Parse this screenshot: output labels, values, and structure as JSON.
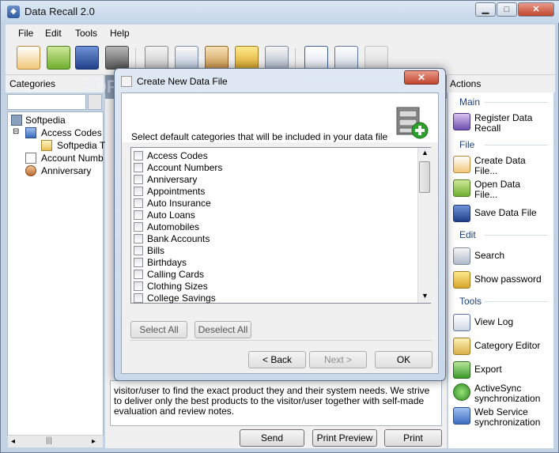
{
  "window": {
    "title": "Data Recall  2.0",
    "min": "▁",
    "max": "□",
    "close": "✕"
  },
  "menu": [
    "File",
    "Edit",
    "Tools",
    "Help"
  ],
  "categories": {
    "header": "Categories",
    "tree": [
      "Softpedia",
      "Access Codes",
      "Softpedia T",
      "Account Numb",
      "Anniversary"
    ],
    "scroll_grip": "|||"
  },
  "center": {
    "header_text": "SOFTPEDIA",
    "description": "visitor/user to find the exact product they and their system needs. We strive to deliver only the best products to the visitor/user together with self-made evaluation and review notes.",
    "buttons": {
      "send": "Send",
      "print_preview": "Print Preview",
      "print": "Print"
    }
  },
  "actions": {
    "header": "Actions",
    "sections": {
      "main": "Main",
      "file": "File",
      "edit": "Edit",
      "tools": "Tools"
    },
    "items": {
      "register": "Register Data Recall",
      "create": "Create Data File...",
      "open": "Open Data File...",
      "save": "Save Data File",
      "search": "Search",
      "show_password": "Show password",
      "view_log": "View Log",
      "category_editor": "Category Editor",
      "export": "Export",
      "activesync": "ActiveSync synchronization",
      "webservice": "Web Service synchronization"
    }
  },
  "dialog": {
    "title": "Create New Data File",
    "close": "✕",
    "instruction": "Select default categories that will be included in your data file",
    "categories": [
      "Access Codes",
      "Account Numbers",
      "Anniversary",
      "Appointments",
      "Auto Insurance",
      "Auto Loans",
      "Automobiles",
      "Bank Accounts",
      "Bills",
      "Birthdays",
      "Calling Cards",
      "Clothing Sizes",
      "College Savings"
    ],
    "select_all": "Select All",
    "deselect_all": "Deselect All",
    "back": "< Back",
    "next": "Next >",
    "ok": "OK"
  }
}
